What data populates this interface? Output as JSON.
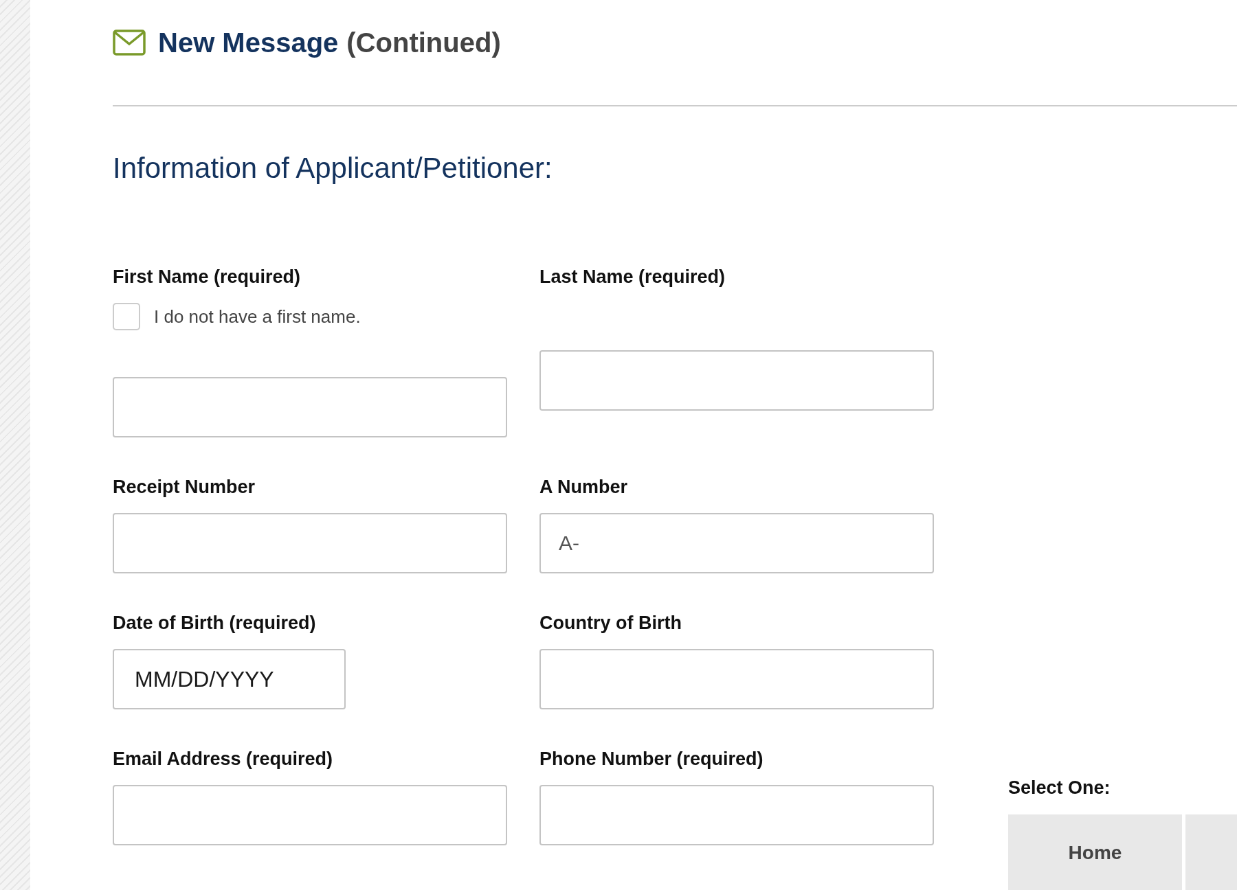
{
  "header": {
    "title": "New Message",
    "suffix": "(Continued)"
  },
  "section": {
    "heading": "Information of Applicant/Petitioner:"
  },
  "rows": [
    [
      {
        "label": "First Name (required)",
        "kind": "text",
        "checkbox": {
          "label": "I do not have a first name.",
          "checked": false
        }
      },
      {
        "label": "Last Name (required)",
        "kind": "text"
      }
    ],
    [
      {
        "label": "Receipt Number",
        "kind": "text"
      },
      {
        "label": "A Number",
        "kind": "text",
        "placeholder": "A-"
      }
    ],
    [
      {
        "label": "Date of Birth (required)",
        "kind": "date",
        "placeholder": "MM/DD/YYYY"
      },
      {
        "label": "Country of Birth",
        "kind": "text"
      }
    ],
    [
      {
        "label": "Email Address (required)",
        "kind": "text"
      },
      {
        "label": "Phone Number (required)",
        "kind": "text"
      }
    ]
  ],
  "phone_type": {
    "label": "Select One:",
    "options": [
      {
        "label": "Home",
        "selected": false
      }
    ]
  }
}
